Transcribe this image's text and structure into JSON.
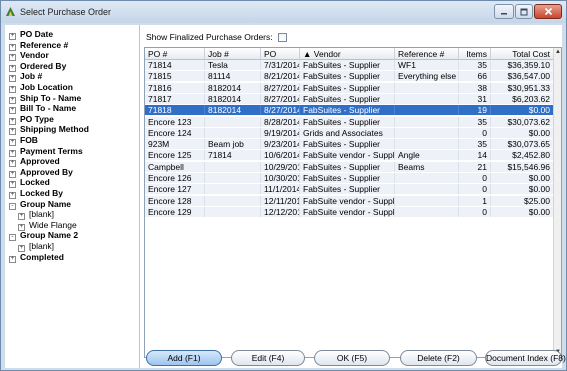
{
  "window": {
    "title": "Select Purchase Order",
    "controls": {
      "minimize": "minimize-icon",
      "maximize": "maximize-icon",
      "close": "close-icon"
    }
  },
  "tree": {
    "items": [
      {
        "label": "PO Date",
        "level": 0,
        "expander": "+"
      },
      {
        "label": "Reference #",
        "level": 0,
        "expander": "+"
      },
      {
        "label": "Vendor",
        "level": 0,
        "expander": "+"
      },
      {
        "label": "Ordered By",
        "level": 0,
        "expander": "+"
      },
      {
        "label": "Job #",
        "level": 0,
        "expander": "+"
      },
      {
        "label": "Job Location",
        "level": 0,
        "expander": "+"
      },
      {
        "label": "Ship To - Name",
        "level": 0,
        "expander": "+"
      },
      {
        "label": "Bill To - Name",
        "level": 0,
        "expander": "+"
      },
      {
        "label": "PO Type",
        "level": 0,
        "expander": "+"
      },
      {
        "label": "Shipping Method",
        "level": 0,
        "expander": "+"
      },
      {
        "label": "FOB",
        "level": 0,
        "expander": "+"
      },
      {
        "label": "Payment Terms",
        "level": 0,
        "expander": "+"
      },
      {
        "label": "Approved",
        "level": 0,
        "expander": "+"
      },
      {
        "label": "Approved By",
        "level": 0,
        "expander": "+"
      },
      {
        "label": "Locked",
        "level": 0,
        "expander": "+"
      },
      {
        "label": "Locked By",
        "level": 0,
        "expander": "+"
      },
      {
        "label": "Group Name",
        "level": 0,
        "expander": "-"
      },
      {
        "label": "[blank]",
        "level": 1,
        "expander": "+"
      },
      {
        "label": "Wide Flange",
        "level": 1,
        "expander": "+"
      },
      {
        "label": "Group Name 2",
        "level": 0,
        "expander": "-"
      },
      {
        "label": "[blank]",
        "level": 1,
        "expander": "+"
      },
      {
        "label": "Completed",
        "level": 0,
        "expander": "+"
      }
    ]
  },
  "filter": {
    "label": "Show Finalized Purchase Orders:",
    "checked": false
  },
  "grid": {
    "columns": [
      {
        "label": "PO #"
      },
      {
        "label": "Job #"
      },
      {
        "label": "PO"
      },
      {
        "label": "▲ Vendor"
      },
      {
        "label": "Reference #"
      },
      {
        "label": "Items"
      },
      {
        "label": "Total Cost"
      }
    ],
    "selected_index": 4,
    "rows": [
      [
        "71814",
        "Tesla",
        "7/31/2014",
        "FabSuites - Supplier",
        "WF1",
        "35",
        "$36,359.10"
      ],
      [
        "71815",
        "81114",
        "8/21/2014",
        "FabSuites - Supplier",
        "Everything else",
        "66",
        "$36,547.00"
      ],
      [
        "71816",
        "8182014",
        "8/27/2014",
        "FabSuites - Supplier",
        "",
        "38",
        "$30,951.33"
      ],
      [
        "71817",
        "8182014",
        "8/27/2014",
        "FabSuites - Supplier",
        "",
        "31",
        "$6,203.62"
      ],
      [
        "71818",
        "8182014",
        "8/27/2014",
        "FabSuites - Supplier",
        "",
        "19",
        "$0.00"
      ],
      [
        "Encore 123",
        "",
        "8/28/2014",
        "FabSuites - Supplier",
        "",
        "35",
        "$30,073.62"
      ],
      [
        "Encore 124",
        "",
        "9/19/2014",
        "Grids and Associates",
        "",
        "0",
        "$0.00"
      ],
      [
        "923M",
        "Beam job",
        "9/23/2014",
        "FabSuites - Supplier",
        "",
        "35",
        "$30,073.65"
      ],
      [
        "Encore 125",
        "71814",
        "10/6/2014",
        "FabSuite vendor - Suppli",
        "Angle",
        "14",
        "$2,452.80"
      ],
      [
        "Campbell",
        "",
        "10/29/201",
        "FabSuites - Supplier",
        "Beams",
        "21",
        "$15,546.96"
      ],
      [
        "Encore 126",
        "",
        "10/30/201",
        "FabSuites - Supplier",
        "",
        "0",
        "$0.00"
      ],
      [
        "Encore 127",
        "",
        "11/1/2014",
        "FabSuites - Supplier",
        "",
        "0",
        "$0.00"
      ],
      [
        "Encore 128",
        "",
        "12/11/201",
        "FabSuite vendor - Suppli",
        "",
        "1",
        "$25.00"
      ],
      [
        "Encore 129",
        "",
        "12/12/201",
        "FabSuite vendor - Suppli",
        "",
        "0",
        "$0.00"
      ]
    ]
  },
  "buttons": {
    "add": "Add (F1)",
    "edit": "Edit (F4)",
    "ok": "OK (F5)",
    "delete": "Delete (F2)",
    "document_index": "Document Index (F8)"
  },
  "colors": {
    "selected_row": "#2f6fc8",
    "row_band": "#eef2f8",
    "titlebar": "#c5d5e8",
    "close_button": "#c9452e"
  }
}
